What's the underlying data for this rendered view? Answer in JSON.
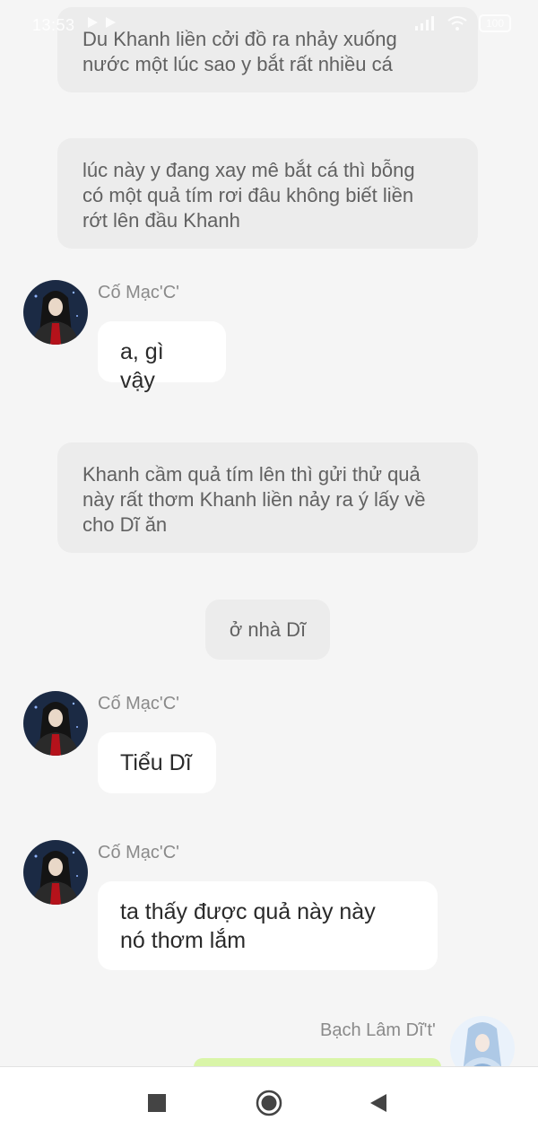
{
  "status": {
    "time": "13:53",
    "battery": "100"
  },
  "narration": [
    {
      "lines": [
        "Du Khanh liền cởi đồ ra nhảy xuống",
        "nước một lúc sao y bắt rất nhiều cá"
      ]
    },
    {
      "lines": [
        "lúc này y đang xay mê bắt cá thì bỗng",
        "có một quả tím rơi đâu không biết liền",
        "rớt lên đầu Khanh"
      ]
    },
    {
      "lines": [
        "Khanh cầm quả tím lên thì gửi thử quả",
        "này rất thơm Khanh liền nảy ra ý lấy về",
        "cho Dĩ ăn"
      ]
    }
  ],
  "scene_label": "ở nhà Dĩ",
  "messages": [
    {
      "sender": "Cố Mạc'C'",
      "lines": [
        "a, gì vậy"
      ]
    },
    {
      "sender": "Cố Mạc'C'",
      "lines": [
        "Tiểu Dĩ"
      ]
    },
    {
      "sender": "Cố Mạc'C'",
      "lines": [
        "ta thấy được quả này này",
        "nó thơm lắm"
      ]
    }
  ],
  "outgoing": {
    "sender": "Bạch Lâm Dĩ't'"
  },
  "colors": {
    "background": "#f5f5f5",
    "narration_bubble": "#ececec",
    "incoming_bubble": "#ffffff",
    "outgoing_bubble": "#d9f5a8"
  },
  "nav": {
    "recents": "stop-square-icon",
    "home": "home-circle-icon",
    "back": "back-triangle-icon"
  }
}
